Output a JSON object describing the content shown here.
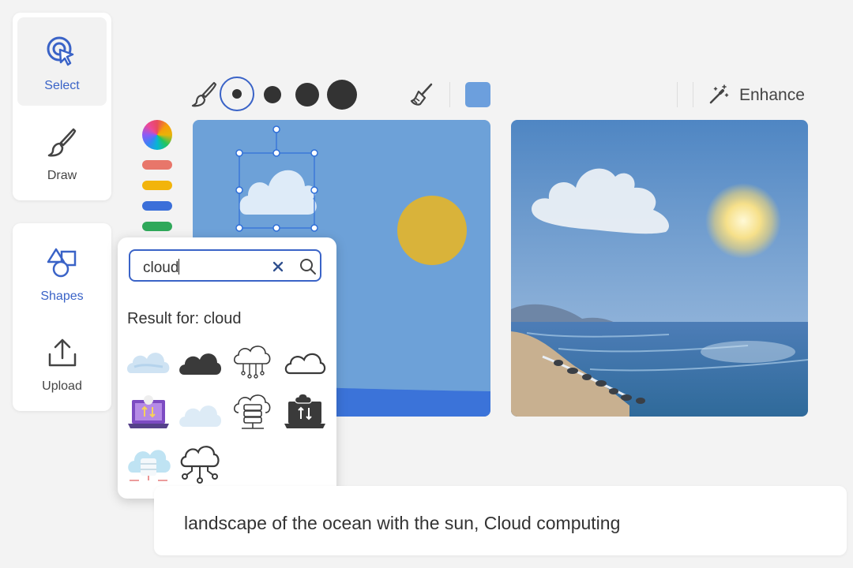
{
  "tools": {
    "select_label": "Select",
    "draw_label": "Draw",
    "shapes_label": "Shapes",
    "upload_label": "Upload"
  },
  "toolbar": {
    "enhance_label": "Enhance",
    "selected_color": "#6c9fdd",
    "brush_sizes": [
      "small",
      "medium",
      "large",
      "x-large"
    ]
  },
  "palette": [
    "rainbow",
    "#e8766a",
    "#f2b40b",
    "#3b6fd9",
    "#2fa85a"
  ],
  "shape_search": {
    "query": "cloud",
    "result_heading": "Result for: cloud",
    "results": [
      "cloud-pastel-icon",
      "cloud-filled-icon",
      "cloud-network-outline-icon",
      "cloud-outline-icon",
      "laptop-cloud-transfer-icon",
      "cloud-light-icon",
      "cloud-server-icon",
      "laptop-cloud-sync-icon",
      "cloud-database-icon",
      "cloud-network-icon"
    ]
  },
  "prompt": {
    "text": "landscape of the ocean with the sun, Cloud computing"
  }
}
